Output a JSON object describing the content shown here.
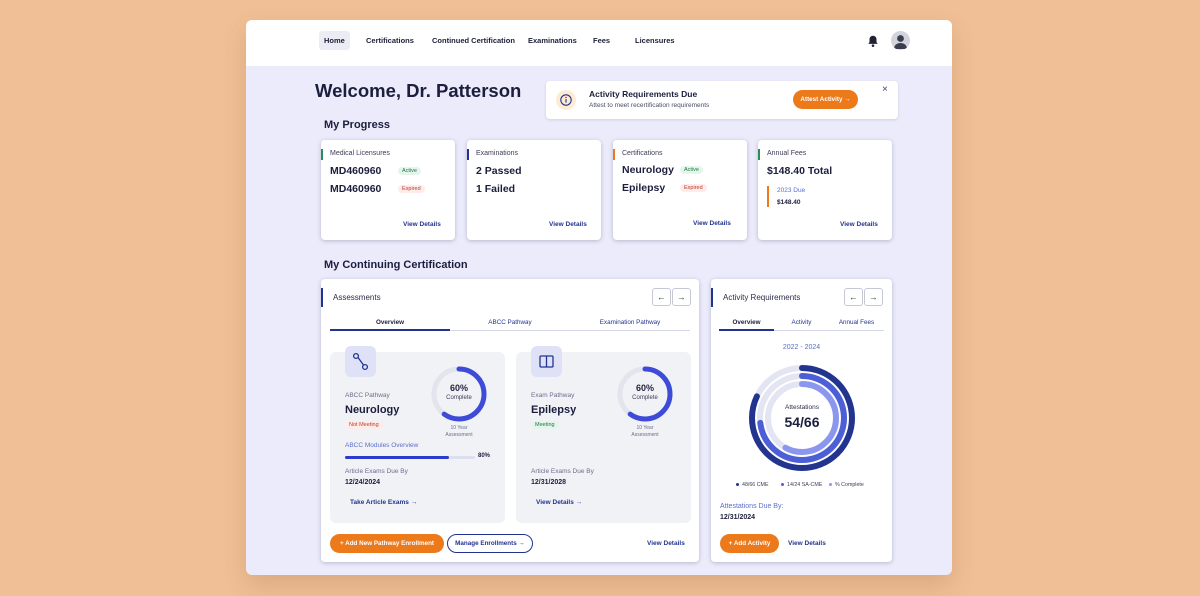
{
  "nav": {
    "items": [
      "Home",
      "Certifications",
      "Continued Certification",
      "Examinations",
      "Fees",
      "Licensures"
    ],
    "active": "Home"
  },
  "welcome": "Welcome, Dr. Patterson",
  "alert": {
    "title": "Activity Requirements Due",
    "subtitle": "Attest to meet recertification requirements",
    "button": "Attest Activity",
    "close": "×"
  },
  "progress": {
    "title": "My Progress",
    "licensures": {
      "label": "Medical Licensures",
      "rows": [
        {
          "id": "MD460960",
          "status": "Active"
        },
        {
          "id": "MD460960",
          "status": "Expired"
        }
      ],
      "link": "View Details",
      "accent": "#2e8b57"
    },
    "examinations": {
      "label": "Examinations",
      "passed": "2 Passed",
      "failed": "1 Failed",
      "link": "View Details",
      "accent": "#23348f"
    },
    "certifications": {
      "label": "Certifications",
      "rows": [
        {
          "name": "Neurology",
          "status": "Active"
        },
        {
          "name": "Epilepsy",
          "status": "Expired"
        }
      ],
      "link": "View Details",
      "accent": "#ec7a1b"
    },
    "fees": {
      "label": "Annual Fees",
      "total": "$148.40 Total",
      "due_label": "2023 Due",
      "due_amount": "$148.40",
      "link": "View Details",
      "accent": "#2e8b57"
    }
  },
  "continuing": {
    "title": "My Continuing Certification",
    "assessments": {
      "title": "Assessments",
      "tabs": [
        "Overview",
        "ABCC Pathway",
        "Examination Pathway"
      ],
      "active_tab": "Overview",
      "abcc": {
        "pathway_label": "ABCC Pathway",
        "name": "Neurology",
        "status": "Not Meeting",
        "percent": "60%",
        "percent_value": 60,
        "complete": "Complete",
        "ring_caption_1": "10 Year",
        "ring_caption_2": "Assessment",
        "modules_label": "ABCC Modules Overview",
        "modules_percent": "80%",
        "modules_value": 80,
        "due_label": "Article Exams Due By",
        "due_date": "12/24/2024",
        "link": "Take Article Exams"
      },
      "exam": {
        "pathway_label": "Exam Pathway",
        "name": "Epilepsy",
        "status": "Meeting",
        "percent": "60%",
        "percent_value": 60,
        "complete": "Complete",
        "ring_caption_1": "10 Year",
        "ring_caption_2": "Assessment",
        "due_label": "Article Exams Due By",
        "due_date": "12/31/2028",
        "link": "View Details"
      },
      "add_button": "Add New Pathway Enrollment",
      "manage_button": "Manage Enrollments",
      "view_details": "View Details"
    },
    "activity": {
      "title": "Activity Requirements",
      "tabs": [
        "Overview",
        "Activity",
        "Annual Fees"
      ],
      "active_tab": "Overview",
      "period": "2022 - 2024",
      "center_label": "Attestations",
      "center_value": "54/66",
      "legend": [
        {
          "label": "48/66 CME",
          "color": "#23348f"
        },
        {
          "label": "14/24 SA-CME",
          "color": "#4d5fd6"
        },
        {
          "label": "% Complete",
          "color": "#8b97ee"
        }
      ],
      "ring_fractions": [
        0.82,
        0.73,
        0.58
      ],
      "due_label": "Attestations Due By:",
      "due_date": "12/31/2024",
      "add_button": "Add Activity",
      "view_details": "View Details"
    }
  }
}
